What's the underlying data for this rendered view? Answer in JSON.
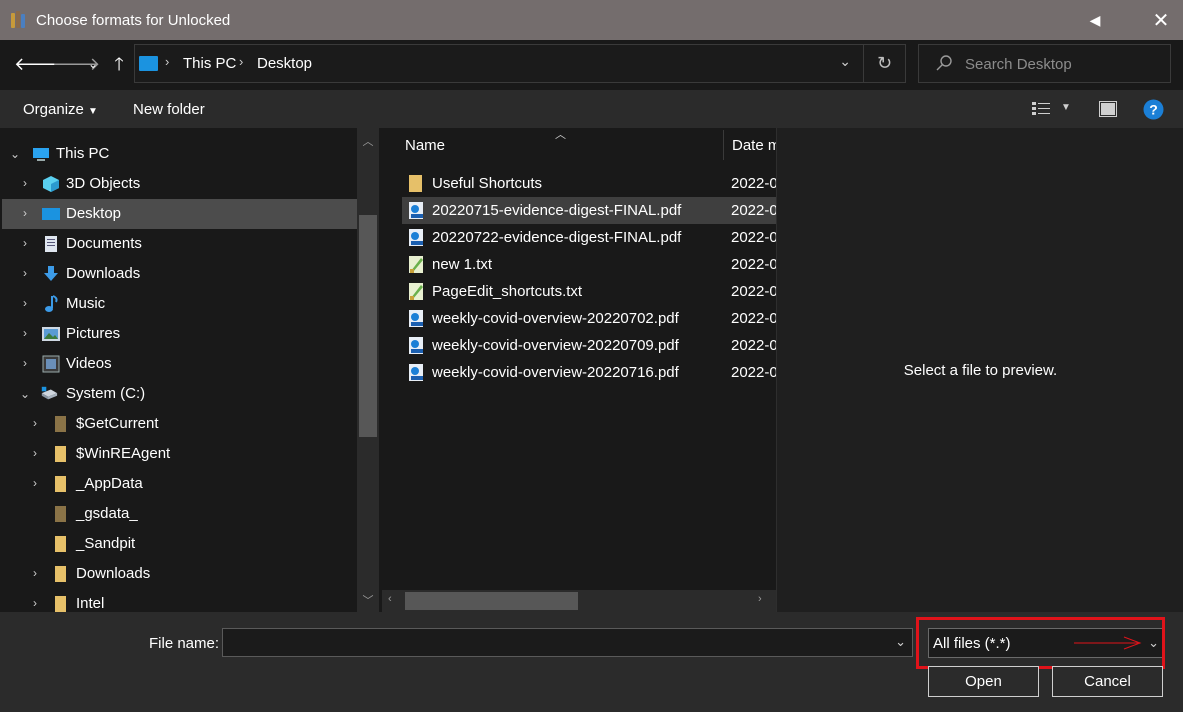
{
  "window": {
    "title": "Choose formats for Unlocked"
  },
  "address": {
    "crumbs": [
      "This PC",
      "Desktop"
    ]
  },
  "search": {
    "placeholder": "Search Desktop"
  },
  "toolbar": {
    "organize_label": "Organize",
    "new_folder_label": "New folder"
  },
  "nav": {
    "items": [
      {
        "label": "This PC",
        "icon": "pc-icon"
      },
      {
        "label": "3D Objects",
        "icon": "cube-icon"
      },
      {
        "label": "Desktop",
        "icon": "desktop-icon"
      },
      {
        "label": "Documents",
        "icon": "documents-icon"
      },
      {
        "label": "Downloads",
        "icon": "download-arrow-icon"
      },
      {
        "label": "Music",
        "icon": "music-note-icon"
      },
      {
        "label": "Pictures",
        "icon": "pictures-icon"
      },
      {
        "label": "Videos",
        "icon": "film-icon"
      },
      {
        "label": "System (C:)",
        "icon": "drive-icon"
      },
      {
        "label": "$GetCurrent",
        "icon": "folder-icon"
      },
      {
        "label": "$WinREAgent",
        "icon": "folder-icon"
      },
      {
        "label": "_AppData",
        "icon": "folder-icon"
      },
      {
        "label": "_gsdata_",
        "icon": "folder-icon"
      },
      {
        "label": "_Sandpit",
        "icon": "folder-icon"
      },
      {
        "label": "Downloads",
        "icon": "folder-icon"
      },
      {
        "label": "Intel",
        "icon": "folder-icon"
      }
    ]
  },
  "filelist": {
    "columns": {
      "name": "Name",
      "date": "Date m"
    },
    "files": [
      {
        "name": "Useful Shortcuts",
        "date": "2022-0",
        "icon": "folder-icon"
      },
      {
        "name": "20220715-evidence-digest-FINAL.pdf",
        "date": "2022-0",
        "icon": "pdf-icon"
      },
      {
        "name": "20220722-evidence-digest-FINAL.pdf",
        "date": "2022-0",
        "icon": "pdf-icon"
      },
      {
        "name": "new 1.txt",
        "date": "2022-0",
        "icon": "text-file-icon"
      },
      {
        "name": "PageEdit_shortcuts.txt",
        "date": "2022-0",
        "icon": "text-file-icon"
      },
      {
        "name": "weekly-covid-overview-20220702.pdf",
        "date": "2022-0",
        "icon": "pdf-icon"
      },
      {
        "name": "weekly-covid-overview-20220709.pdf",
        "date": "2022-0",
        "icon": "pdf-icon"
      },
      {
        "name": "weekly-covid-overview-20220716.pdf",
        "date": "2022-0",
        "icon": "pdf-icon"
      }
    ]
  },
  "preview": {
    "message": "Select a file to preview."
  },
  "bottom": {
    "file_name_label": "File name:",
    "file_name_value": "",
    "filter_value": "All files (*.*)",
    "open_label": "Open",
    "cancel_label": "Cancel"
  },
  "colors": {
    "titlebar": "#746d6d",
    "accent": "#1b93e0",
    "highlight_annotation": "#e0131a",
    "folder": "#e6c069"
  }
}
